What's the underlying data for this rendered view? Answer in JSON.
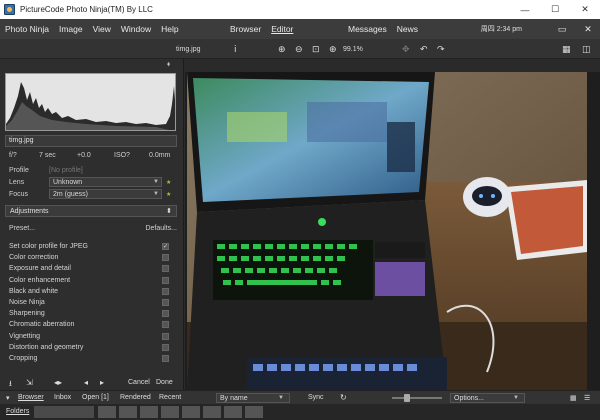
{
  "window": {
    "title": "PictureCode Photo Ninja(TM) By LLC",
    "minimize": "—",
    "maximize": "☐",
    "close": "✕"
  },
  "menu": {
    "left": [
      "Photo Ninja",
      "Image",
      "View",
      "Window",
      "Help"
    ],
    "center": [
      "Browser",
      "Editor"
    ],
    "right": [
      "Messages",
      "News"
    ],
    "clock": "周四 2:34 pm"
  },
  "toolbar": {
    "filename": "timg.jpg",
    "zoom_level": "99.1%"
  },
  "panel": {
    "file_label": "timg.jpg",
    "exif": {
      "fstop": "f/?",
      "shutter": "7 sec",
      "ev": "+0.0",
      "iso": "ISO?",
      "focal": "0.0mm"
    },
    "profile_label": "Profile",
    "profile_value": "[No profile]",
    "lens_label": "Lens",
    "lens_value": "Unknown",
    "focus_label": "Focus",
    "focus_value": "2m (guess)",
    "adjustments_label": "Adjustments",
    "preset_label": "Preset...",
    "defaults_label": "Defaults...",
    "adjustments": [
      {
        "label": "Set color profile for JPEG",
        "checked": true
      },
      {
        "label": "Color correction",
        "checked": false
      },
      {
        "label": "Exposure and detail",
        "checked": false
      },
      {
        "label": "Color enhancement",
        "checked": false
      },
      {
        "label": "Black and white",
        "checked": false
      },
      {
        "label": "Noise Ninja",
        "checked": false
      },
      {
        "label": "Sharpening",
        "checked": false
      },
      {
        "label": "Chromatic aberration",
        "checked": false
      },
      {
        "label": "Vignetting",
        "checked": false
      },
      {
        "label": "Distortion and geometry",
        "checked": false
      },
      {
        "label": "Cropping",
        "checked": false
      }
    ],
    "cancel_label": "Cancel",
    "done_label": "Done"
  },
  "bottom": {
    "tabs": [
      "Browser",
      "Inbox",
      "Open [1]",
      "Rendered",
      "Recent"
    ],
    "sort_value": "By name",
    "sync_label": "Sync",
    "options_label": "Options...",
    "folders_label": "Folders"
  },
  "colors": {
    "accent_green": "#9cc23a",
    "panel_bg": "#2e2e2e",
    "menubar_bg": "#3c3c3c"
  }
}
